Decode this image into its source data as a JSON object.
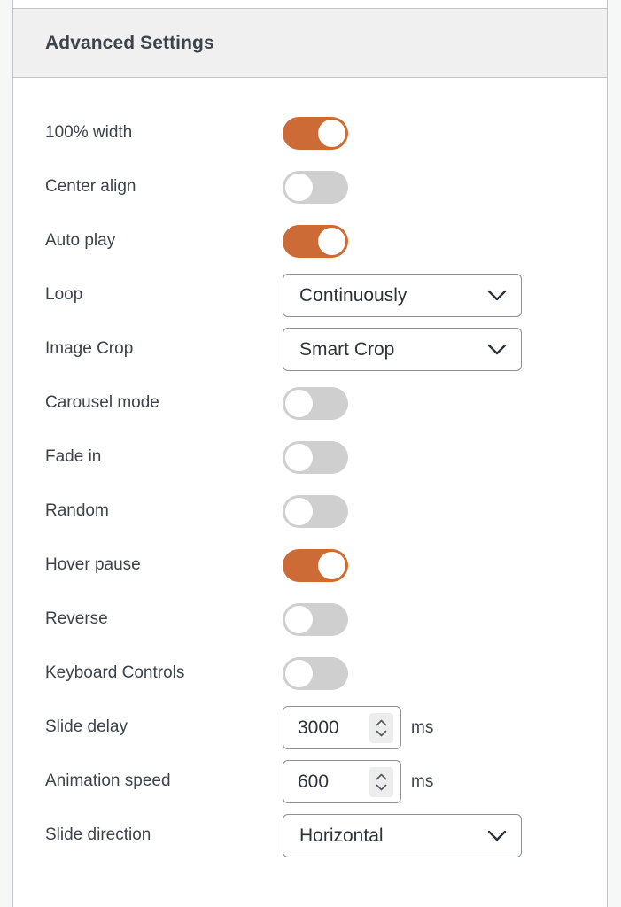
{
  "panel": {
    "header_title": "Advanced Settings",
    "accent_color": "#cc6b35",
    "toggle_off_color": "#cfcfcf",
    "header_bg": "#f0f0f1",
    "border_color": "#c3c4c7",
    "label_color": "#3c434a"
  },
  "settings": [
    {
      "label": "100% width",
      "type": "toggle",
      "value": "on"
    },
    {
      "label": "Center align",
      "type": "toggle",
      "value": "off"
    },
    {
      "label": "Auto play",
      "type": "toggle",
      "value": "on"
    },
    {
      "label": "Loop",
      "type": "select",
      "value": "Continuously"
    },
    {
      "label": "Image Crop",
      "type": "select",
      "value": "Smart Crop"
    },
    {
      "label": "Carousel mode",
      "type": "toggle",
      "value": "off"
    },
    {
      "label": "Fade in",
      "type": "toggle",
      "value": "off"
    },
    {
      "label": "Random",
      "type": "toggle",
      "value": "off"
    },
    {
      "label": "Hover pause",
      "type": "toggle",
      "value": "on"
    },
    {
      "label": "Reverse",
      "type": "toggle",
      "value": "off"
    },
    {
      "label": "Keyboard Controls",
      "type": "toggle",
      "value": "off"
    },
    {
      "label": "Slide delay",
      "type": "number",
      "value": "3000",
      "unit": "ms"
    },
    {
      "label": "Animation speed",
      "type": "number",
      "value": "600",
      "unit": "ms"
    },
    {
      "label": "Slide direction",
      "type": "select",
      "value": "Horizontal"
    }
  ],
  "icons": {
    "chevron_down": "chevron-down-icon",
    "spinner_up": "spinner-up-arrow-icon",
    "spinner_down": "spinner-down-arrow-icon"
  }
}
